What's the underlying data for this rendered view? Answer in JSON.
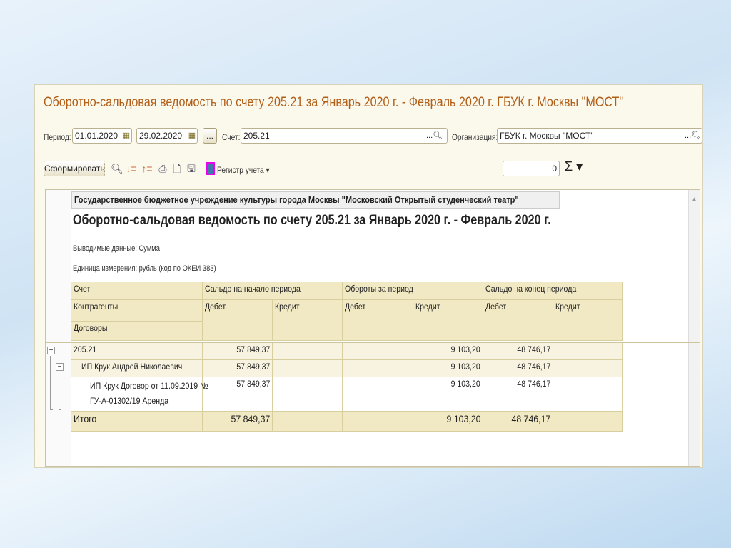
{
  "title": "Оборотно-сальдовая ведомость по счету 205.21 за Январь 2020 г. - Февраль 2020 г. ГБУК г. Москвы \"МОСТ\"",
  "filters": {
    "period_label": "Период:",
    "date_from": "01.01.2020",
    "date_to": "29.02.2020",
    "dots": "...",
    "account_label": "Счет:",
    "account": "205.21",
    "org_label": "Организация:",
    "org": "ГБУК г. Москвы \"МОСТ\""
  },
  "toolbar": {
    "generate": "Сформировать",
    "register": "Регистр учета ▾",
    "counter": "0",
    "sigma": "Σ ▾"
  },
  "report": {
    "org_full": "Государственное бюджетное учреждение культуры города Москвы \"Московский Открытый студенческий театр\"",
    "heading": "Оборотно-сальдовая ведомость по счету 205.21 за Январь 2020 г. - Февраль 2020 г.",
    "output": "Выводимые данные:  Сумма",
    "units": "Единица измерения: рубль (код по ОКЕИ 383)",
    "headers": {
      "account": "Счет",
      "counterparty": "Контрагенты",
      "contracts": "Договоры",
      "open": "Сальдо на начало периода",
      "turnover": "Обороты за период",
      "close": "Сальдо на конец периода",
      "debit": "Дебет",
      "credit": "Кредит"
    },
    "rows": [
      {
        "name": "205.21",
        "open_debit": "57 849,37",
        "turn_credit": "9 103,20",
        "close_debit": "48 746,17"
      },
      {
        "name": "ИП Крук Андрей Николаевич",
        "open_debit": "57 849,37",
        "turn_credit": "9 103,20",
        "close_debit": "48 746,17"
      },
      {
        "name": "ИП Крук Договор от 11.09.2019 №",
        "name2": "ГУ-А-01302/19 Аренда",
        "open_debit": "57 849,37",
        "turn_credit": "9 103,20",
        "close_debit": "48 746,17"
      },
      {
        "name": "Итого",
        "open_debit": "57 849,37",
        "turn_credit": "9 103,20",
        "close_debit": "48 746,17"
      }
    ]
  }
}
